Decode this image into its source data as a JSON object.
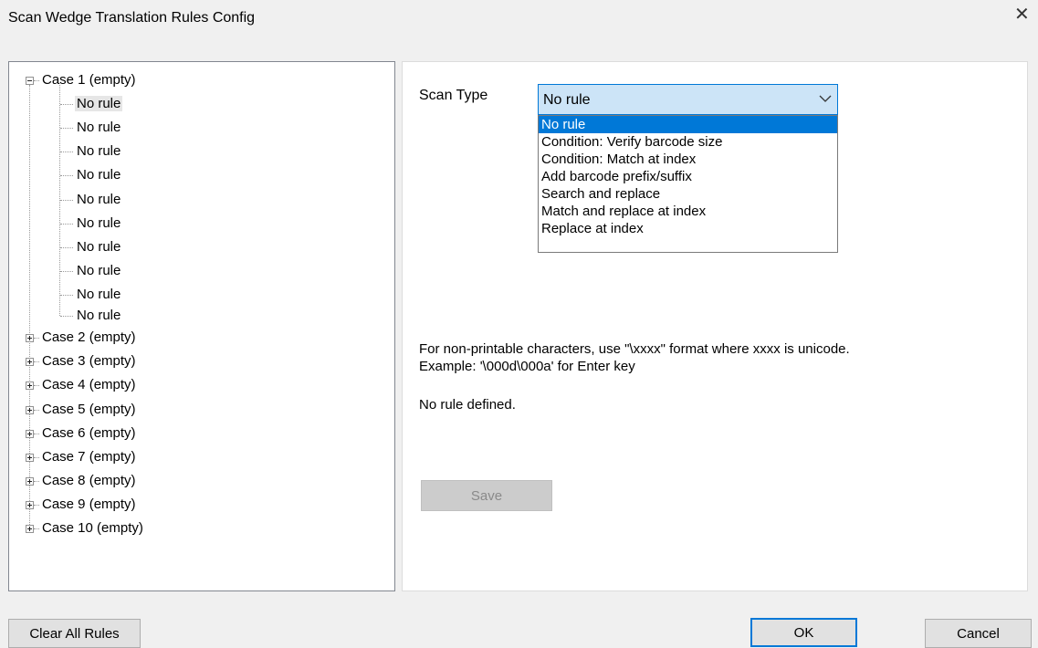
{
  "window": {
    "title": "Scan Wedge Translation Rules Config",
    "close_glyph": "✕"
  },
  "tree": {
    "case1": {
      "label": "Case 1 (empty)",
      "rules": [
        "No rule",
        "No rule",
        "No rule",
        "No rule",
        "No rule",
        "No rule",
        "No rule",
        "No rule",
        "No rule",
        "No rule"
      ]
    },
    "cases": [
      "Case 2 (empty)",
      "Case 3 (empty)",
      "Case 4 (empty)",
      "Case 5 (empty)",
      "Case 6 (empty)",
      "Case 7 (empty)",
      "Case 8 (empty)",
      "Case 9 (empty)",
      "Case 10 (empty)"
    ]
  },
  "rule_panel": {
    "scan_type_label": "Scan Type",
    "scan_type_value": "No rule",
    "options": [
      "No rule",
      "Condition: Verify barcode size",
      "Condition: Match at index",
      "Add barcode prefix/suffix",
      "Search and replace",
      "Match and replace at index",
      "Replace at index"
    ],
    "info_line1": "For non-printable characters, use \"\\xxxx\" format where xxxx is unicode.",
    "info_line2": "Example: '\\000d\\000a' for Enter key",
    "status": "No rule defined.",
    "save_label": "Save"
  },
  "footer": {
    "clear_label": "Clear All Rules",
    "ok_label": "OK",
    "cancel_label": "Cancel"
  },
  "colors": {
    "accent": "#0078d7",
    "combo_bg": "#cce4f7",
    "window_bg": "#f0f0f0"
  }
}
